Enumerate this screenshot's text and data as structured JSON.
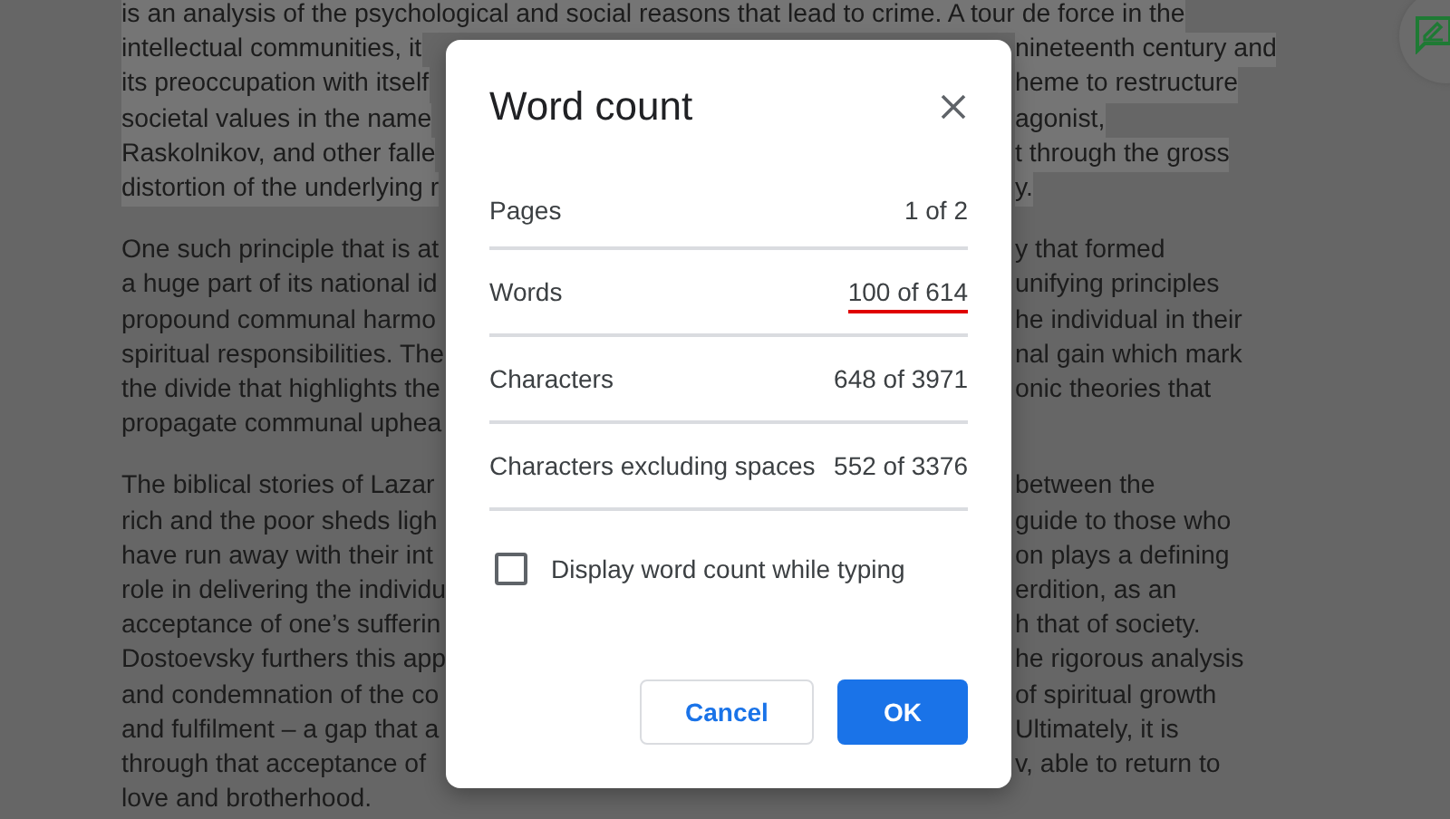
{
  "document": {
    "paragraphs": [
      {
        "selected": true,
        "lines": [
          {
            "text": "is an analysis of the psychological and social reasons that lead to crime. A tour de force in the"
          },
          {
            "left": "intellectual communities, it",
            "right": "nineteenth century and"
          },
          {
            "left": "its preoccupation with itself",
            "right": "heme to restructure"
          },
          {
            "left": "societal values in the name",
            "right": "agonist,"
          },
          {
            "left": "Raskolnikov, and other falle",
            "right": "t through the gross"
          },
          {
            "left": "distortion of the underlying r",
            "right": "y."
          }
        ]
      },
      {
        "selected": false,
        "lines": [
          {
            "left": "One such principle that is at",
            "right": "y that formed"
          },
          {
            "left": "a huge part of its national id",
            "right": "unifying principles"
          },
          {
            "left": "propound communal harmo",
            "right": "he individual in their"
          },
          {
            "left": "spiritual responsibilities. The",
            "right": "nal gain which mark"
          },
          {
            "left": "the divide that highlights the",
            "right": "onic theories that"
          },
          {
            "left": "propagate communal uphea"
          }
        ]
      },
      {
        "selected": false,
        "lines": [
          {
            "left": "The biblical stories of Lazar",
            "right": "between the"
          },
          {
            "left": "rich and the poor sheds ligh",
            "right": "guide to those who"
          },
          {
            "left": "have run away with their int",
            "right": "on plays a defining"
          },
          {
            "left": "role in delivering the individu",
            "right": "erdition, as an"
          },
          {
            "left": "acceptance of one’s sufferin",
            "right": "h that of society."
          },
          {
            "left": "Dostoevsky furthers this app",
            "right": "he rigorous analysis"
          },
          {
            "left": "and condemnation of the co",
            "right": "of spiritual growth"
          },
          {
            "left": "and fulfilment – a gap that a",
            "right": "Ultimately, it is"
          },
          {
            "left": "through that acceptance of",
            "right": "v, able to return to"
          },
          {
            "text": "love and brotherhood."
          }
        ]
      }
    ]
  },
  "dialog": {
    "title": "Word count",
    "rows": [
      {
        "label": "Pages",
        "value": "1 of 2",
        "underlined": false
      },
      {
        "label": "Words",
        "value": "100 of 614",
        "underlined": true
      },
      {
        "label": "Characters",
        "value": "648 of 3971",
        "underlined": false
      },
      {
        "label": "Characters excluding spaces",
        "value": "552 of 3376",
        "underlined": false
      }
    ],
    "checkbox": {
      "label": "Display word count while typing",
      "checked": false
    },
    "buttons": [
      {
        "label": "Cancel",
        "kind": "secondary"
      },
      {
        "label": "OK",
        "kind": "primary"
      }
    ]
  }
}
